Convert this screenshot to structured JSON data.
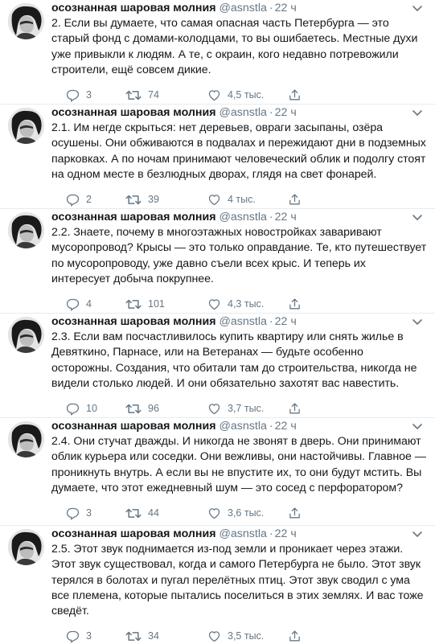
{
  "tweets": [
    {
      "name": "осознанная шаровая молния",
      "handle": "@asnstla",
      "dot": "·",
      "time": "22 ч",
      "text": "2. Если вы думаете, что самая опасная часть Петербурга — это старый фонд с домами-колодцами, то вы ошибаетесь. Местные духи уже привыкли к людям. А те, с окраин, кого недавно потревожили строители, ещё совсем дикие.",
      "replies": "3",
      "retweets": "74",
      "likes": "4,5 тыс."
    },
    {
      "name": "осознанная шаровая молния",
      "handle": "@asnstla",
      "dot": "·",
      "time": "22 ч",
      "text": "2.1. Им негде скрыться: нет деревьев, овраги засыпаны, озёра осушены. Они обживаются в подвалах и пережидают дни в подземных парковках. А по ночам принимают человеческий облик и подолгу стоят на одном месте в безлюдных дворах, глядя на свет фонарей.",
      "replies": "2",
      "retweets": "39",
      "likes": "4 тыс."
    },
    {
      "name": "осознанная шаровая молния",
      "handle": "@asnstla",
      "dot": "·",
      "time": "22 ч",
      "text": "2.2. Знаете, почему в многоэтажных новостройках заваривают мусоропровод? Крысы — это только оправдание. Те, кто путешествует по мусоропроводу, уже давно съели всех крыс. И теперь их интересует добыча покрупнее.",
      "replies": "4",
      "retweets": "101",
      "likes": "4,3 тыс."
    },
    {
      "name": "осознанная шаровая молния",
      "handle": "@asnstla",
      "dot": "·",
      "time": "22 ч",
      "text": "2.3. Если вам посчастливилось купить квартиру или снять жилье в Девяткино, Парнасе, или на Ветеранах — будьте особенно осторожны. Создания, что обитали там до строительства, никогда не видели столько людей. И они обязательно захотят вас навестить.",
      "replies": "10",
      "retweets": "96",
      "likes": "3,7 тыс."
    },
    {
      "name": "осознанная шаровая молния",
      "handle": "@asnstla",
      "dot": "·",
      "time": "22 ч",
      "text": "2.4. Они стучат дважды. И никогда не звонят в дверь. Они принимают облик курьера или соседки. Они вежливы, они настойчивы. Главное — проникнуть внутрь. А если вы не впустите их, то они будут мстить. Вы думаете, что этот ежедневный шум — это сосед с перфоратором?",
      "replies": "3",
      "retweets": "44",
      "likes": "3,6 тыс."
    },
    {
      "name": "осознанная шаровая молния",
      "handle": "@asnstla",
      "dot": "·",
      "time": "22 ч",
      "text": "2.5. Этот звук поднимается из-под земли и проникает через этажи. Этот звук существовал, когда и самого Петербурга не было. Этот звук терялся в болотах и пугал перелётных птиц. Этот звук сводил с ума все племена, которые пытались поселиться в этих землях. И вас тоже сведёт.",
      "replies": "3",
      "retweets": "34",
      "likes": "3,5 тыс."
    }
  ],
  "icons": {
    "avatar": "avatar-portrait",
    "caret": "chevron-down-icon",
    "reply": "reply-icon",
    "retweet": "retweet-icon",
    "like": "heart-icon",
    "share": "share-icon"
  },
  "colors": {
    "text": "#14171a",
    "secondary": "#657786",
    "border": "#e6ecf0"
  }
}
